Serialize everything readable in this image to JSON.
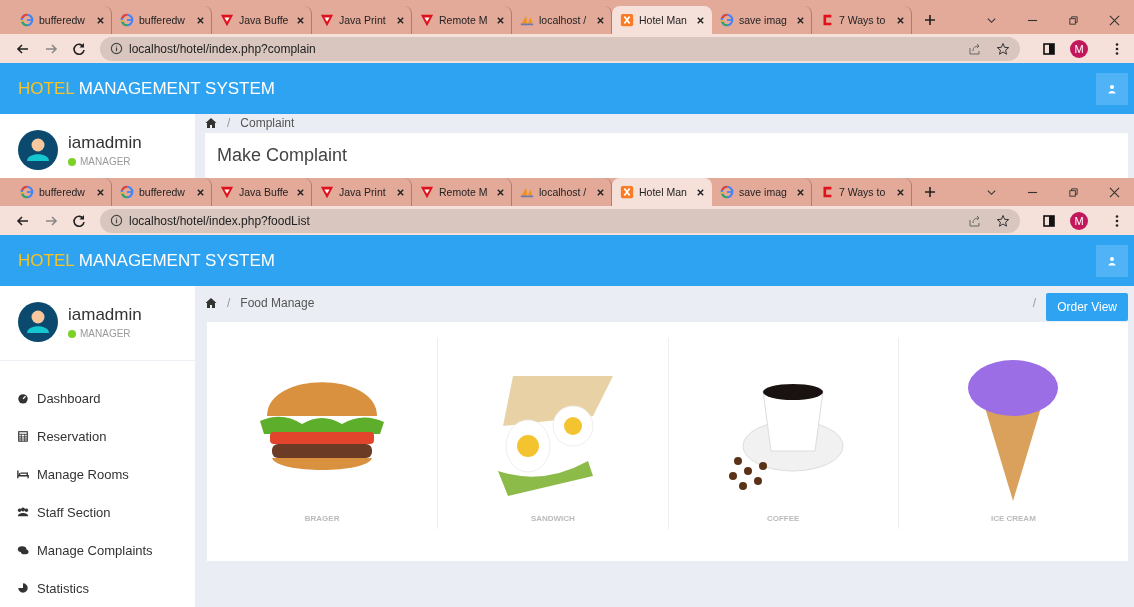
{
  "windows": [
    {
      "tabs": [
        {
          "title": "bufferedw",
          "kind": "google",
          "selected": false
        },
        {
          "title": "bufferedw",
          "kind": "google",
          "selected": false
        },
        {
          "title": "Java Buffe",
          "kind": "triangle",
          "selected": false
        },
        {
          "title": "Java Print",
          "kind": "triangle",
          "selected": false
        },
        {
          "title": "Remote M",
          "kind": "triangle",
          "selected": false
        },
        {
          "title": "localhost /",
          "kind": "pma",
          "selected": false
        },
        {
          "title": "Hotel Man",
          "kind": "xampp",
          "selected": true
        },
        {
          "title": "save imag",
          "kind": "google",
          "selected": false
        },
        {
          "title": "7 Ways to",
          "kind": "letter",
          "selected": false
        }
      ],
      "address": "localhost/hotel/index.php?complain",
      "profile_initial": "M",
      "app": {
        "brand_highlight": "HOTEL",
        "brand_rest": "MANAGEMENT SYSTEM",
        "user": {
          "name": "iamadmin",
          "role": "MANAGER"
        },
        "separators": [
          "/"
        ],
        "breadcrumb": "Complaint",
        "card_title": "Make Complaint"
      }
    },
    {
      "tabs": [
        {
          "title": "bufferedw",
          "kind": "google",
          "selected": false
        },
        {
          "title": "bufferedw",
          "kind": "google",
          "selected": false
        },
        {
          "title": "Java Buffe",
          "kind": "triangle",
          "selected": false
        },
        {
          "title": "Java Print",
          "kind": "triangle",
          "selected": false
        },
        {
          "title": "Remote M",
          "kind": "triangle",
          "selected": false
        },
        {
          "title": "localhost /",
          "kind": "pma",
          "selected": false
        },
        {
          "title": "Hotel Man",
          "kind": "xampp",
          "selected": true
        },
        {
          "title": "save imag",
          "kind": "google",
          "selected": false
        },
        {
          "title": "7 Ways to",
          "kind": "letter",
          "selected": false
        }
      ],
      "address": "localhost/hotel/index.php?foodList",
      "profile_initial": "M",
      "app": {
        "brand_highlight": "HOTEL",
        "brand_rest": "MANAGEMENT SYSTEM",
        "user": {
          "name": "iamadmin",
          "role": "MANAGER"
        },
        "separators": [
          "/",
          "/"
        ],
        "breadcrumb": "Food Manage",
        "action_button": "Order View",
        "menu": [
          {
            "label": "Dashboard",
            "kind": "dashboard"
          },
          {
            "label": "Reservation",
            "kind": "calendar"
          },
          {
            "label": "Manage Rooms",
            "kind": "bed"
          },
          {
            "label": "Staff Section",
            "kind": "users"
          },
          {
            "label": "Manage Complaints",
            "kind": "comments"
          },
          {
            "label": "Statistics",
            "kind": "chart"
          }
        ],
        "foods": [
          {
            "name": "BRAGER",
            "kind": "burger"
          },
          {
            "name": "SANDWICH",
            "kind": "sandwich"
          },
          {
            "name": "COFFEE",
            "kind": "coffee"
          },
          {
            "name": "ICE CREAM",
            "kind": "icecream"
          }
        ]
      }
    }
  ]
}
